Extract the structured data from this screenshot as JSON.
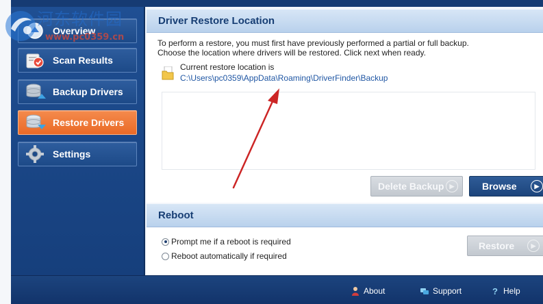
{
  "sidebar": {
    "items": [
      {
        "label": "Overview",
        "icon": "overview-icon",
        "active": false
      },
      {
        "label": "Scan Results",
        "icon": "scan-results-icon",
        "active": false
      },
      {
        "label": "Backup Drivers",
        "icon": "backup-drivers-icon",
        "active": false
      },
      {
        "label": "Restore Drivers",
        "icon": "restore-drivers-icon",
        "active": true
      },
      {
        "label": "Settings",
        "icon": "gear-icon",
        "active": false
      }
    ]
  },
  "watermark": {
    "chinese": "河东软件园",
    "url": "www.pc0359.cn"
  },
  "restore": {
    "title": "Driver Restore Location",
    "description_line1": "To perform a restore, you must first have previously performed a partial or full backup.",
    "description_line2": "Choose the location where drivers will be restored. Click next when ready.",
    "current_label": "Current restore location is",
    "current_path": "C:\\Users\\pc0359\\AppData\\Roaming\\DriverFinder\\Backup",
    "delete_backup_label": "Delete Backup",
    "browse_label": "Browse"
  },
  "reboot": {
    "title": "Reboot",
    "options": [
      {
        "label": "Prompt me if a reboot is required",
        "checked": true
      },
      {
        "label": "Reboot automatically if required",
        "checked": false
      }
    ],
    "restore_label": "Restore"
  },
  "footer": {
    "about": "About",
    "support": "Support",
    "help": "Help"
  },
  "colors": {
    "accent_orange": "#ea6a27",
    "nav_blue": "#1f4f93",
    "link_blue": "#1f56a3",
    "annotation_red": "#cc2525"
  }
}
